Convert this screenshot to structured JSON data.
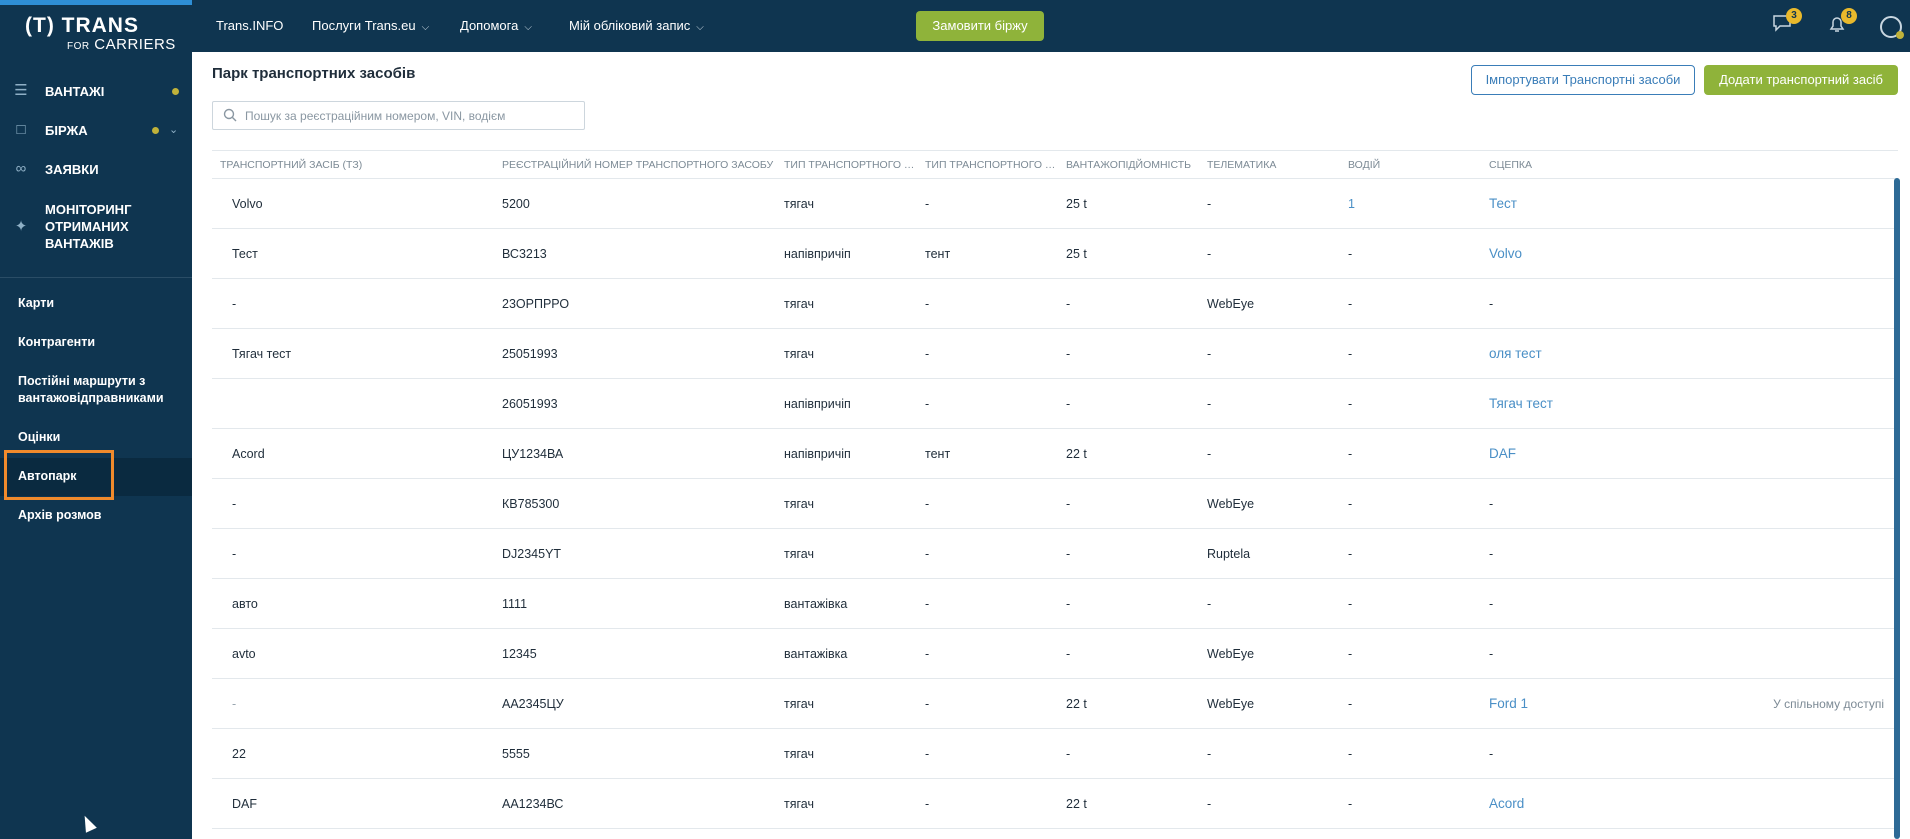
{
  "brand": {
    "line1": "(T) TRANS",
    "for": "FOR",
    "line2": "CARRIERS"
  },
  "sidebar": {
    "main_items": [
      {
        "label": "ВАНТАЖІ",
        "icon": "cargo-icon"
      },
      {
        "label": "БІРЖА",
        "icon": "box-icon"
      },
      {
        "label": "ЗАЯВКИ",
        "icon": "link-icon"
      },
      {
        "label": "МОНІТОРИНГ ОТРИМАНИХ ВАНТАЖІВ",
        "icon": "satellite-icon"
      }
    ],
    "secondary_items": [
      {
        "label": "Карти"
      },
      {
        "label": "Контрагенти"
      },
      {
        "label": "Постійні маршрути з вантажовідправниками"
      },
      {
        "label": "Оцінки"
      },
      {
        "label": "Автопарк"
      },
      {
        "label": "Архів розмов"
      }
    ]
  },
  "topbar": {
    "links": [
      {
        "label": "Trans.INFO",
        "dropdown": false
      },
      {
        "label": "Послуги Trans.eu",
        "dropdown": true
      },
      {
        "label": "Допомога",
        "dropdown": true
      },
      {
        "label": "Мій обліковий запис",
        "dropdown": true
      }
    ],
    "order_button": "Замовити біржу",
    "messages_badge": "3",
    "notifications_badge": "8"
  },
  "page": {
    "title": "Парк транспортних засобів",
    "import_button": "Імпортувати Транспортні засоби",
    "add_button": "Додати транспортний засіб",
    "search_placeholder": "Пошук за реєстраційним номером, VIN, водієм"
  },
  "table": {
    "columns": [
      "ТРАНСПОРТНИЙ ЗАСІБ (ТЗ)",
      "РЕЄСТРАЦІЙНИЙ НОМЕР ТРАНСПОРТНОГО ЗАСОБУ",
      "ТИП ТРАНСПОРТНОГО З...",
      "ТИП ТРАНСПОРТНОГО З...",
      "ВАНТАЖОПІДЙОМНІСТЬ",
      "ТЕЛЕМАТИКА",
      "ВОДІЙ",
      "СЦЕПКА",
      ""
    ],
    "rows": [
      [
        "Volvo",
        "5200",
        "тягач",
        "-",
        "25 t",
        "-",
        "1",
        "Тест",
        ""
      ],
      [
        "Тест",
        "ВС3213",
        "напівпричіп",
        "тент",
        "25 t",
        "-",
        "-",
        "Volvo",
        ""
      ],
      [
        "-",
        "23ОРПРРО",
        "тягач",
        "-",
        "-",
        "WebEye",
        "-",
        "-",
        ""
      ],
      [
        "Тягач тест",
        "25051993",
        "тягач",
        "-",
        "-",
        "-",
        "-",
        "оля тест",
        ""
      ],
      [
        "",
        "26051993",
        "напівпричіп",
        "-",
        "-",
        "-",
        "-",
        "Тягач тест",
        ""
      ],
      [
        "Acord",
        "ЦУ1234ВА",
        "напівпричіп",
        "тент",
        "22 t",
        "-",
        "-",
        "DAF",
        ""
      ],
      [
        "-",
        "КВ785300",
        "тягач",
        "-",
        "-",
        "WebEye",
        "-",
        "-",
        ""
      ],
      [
        "-",
        "DJ2345YT",
        "тягач",
        "-",
        "-",
        "Ruptela",
        "-",
        "-",
        ""
      ],
      [
        "авто",
        "1111",
        "вантажівка",
        "-",
        "-",
        "-",
        "-",
        "-",
        ""
      ],
      [
        "avto",
        "12345",
        "вантажівка",
        "-",
        "-",
        "WebEye",
        "-",
        "-",
        ""
      ],
      [
        "-",
        "АА2345ЦУ",
        "тягач",
        "-",
        "22 t",
        "WebEye",
        "-",
        "Ford 1",
        "У спільному доступі"
      ],
      [
        "22",
        "5555",
        "тягач",
        "-",
        "-",
        "-",
        "-",
        "-",
        ""
      ],
      [
        "DAF",
        "АА1234ВС",
        "тягач",
        "-",
        "22 t",
        "-",
        "-",
        "Acord",
        ""
      ]
    ]
  },
  "colors": {
    "sidebar": "#0f3550",
    "accent_green": "#8fb33a",
    "link": "#4a8fc6",
    "highlight": "#f08a2c",
    "badge": "#e9b92c"
  }
}
